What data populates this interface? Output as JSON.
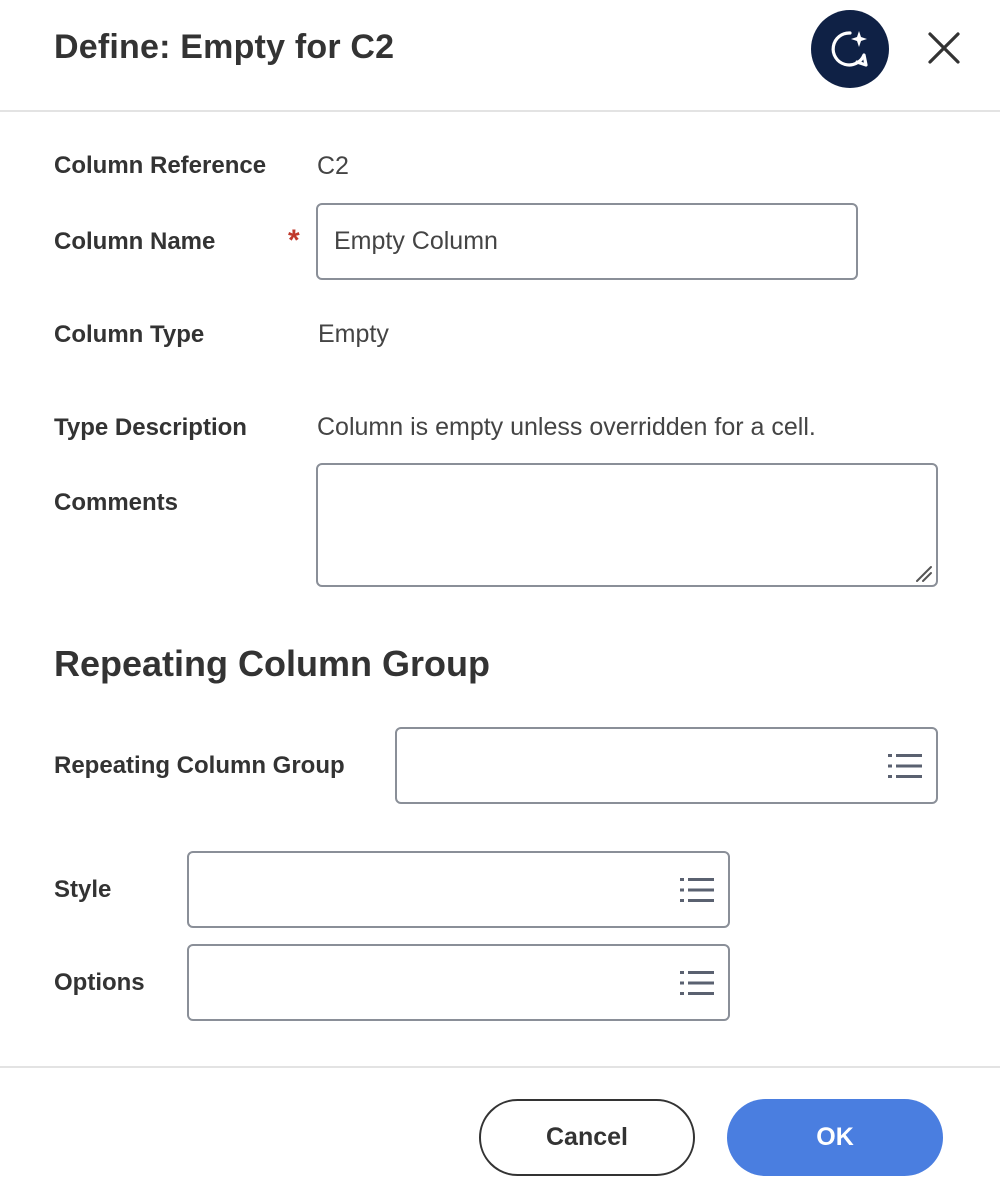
{
  "dialog": {
    "title": "Define: Empty for C2"
  },
  "form": {
    "column_reference_label": "Column Reference",
    "column_reference_value": "C2",
    "column_name_label": "Column Name",
    "required_marker": "*",
    "column_name_value": "Empty Column",
    "column_type_label": "Column Type",
    "column_type_value": "Empty",
    "type_description_label": "Type Description",
    "type_description_value": "Column is empty unless overridden for a cell.",
    "comments_label": "Comments",
    "comments_value": ""
  },
  "repeating_group": {
    "section_title": "Repeating Column Group",
    "repeating_column_group_label": "Repeating Column Group",
    "style_label": "Style",
    "options_label": "Options"
  },
  "footer": {
    "cancel_label": "Cancel",
    "ok_label": "OK"
  },
  "icons": {
    "assistant": "sparkle-chat-icon",
    "close": "close-icon",
    "prompt": "list-icon"
  },
  "colors": {
    "assistant_bg": "#0f2145",
    "ok_button": "#4a7ee0",
    "required": "#c0392b"
  }
}
